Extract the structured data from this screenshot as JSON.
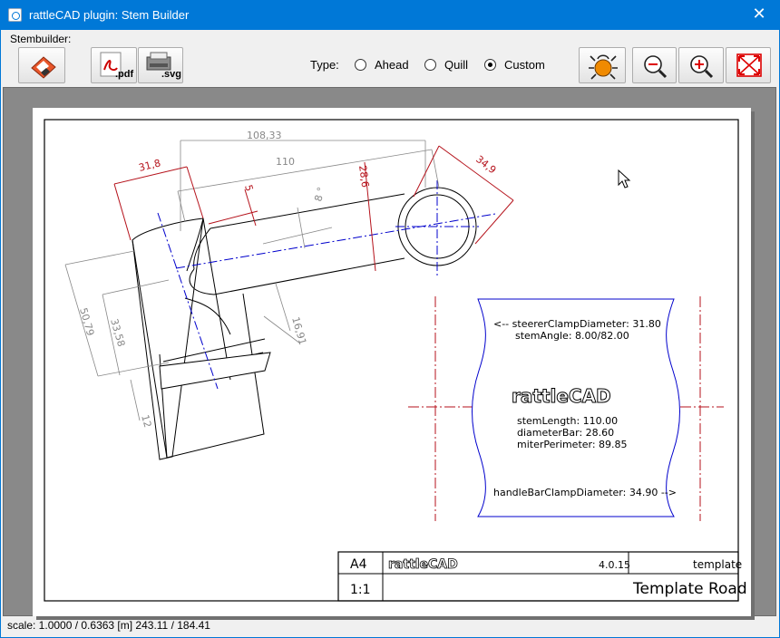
{
  "window": {
    "title": "rattleCAD plugin: Stem Builder",
    "close": "✕"
  },
  "toolbar": {
    "group_label": "Stembuilder:",
    "pdf_label": ".pdf",
    "svg_label": ".svg",
    "type_label": "Type:",
    "types": [
      {
        "label": "Ahead",
        "checked": false
      },
      {
        "label": "Quill",
        "checked": false
      },
      {
        "label": "Custom",
        "checked": true
      }
    ]
  },
  "drawing": {
    "dims": {
      "d108": "108,33",
      "d110": "110",
      "d318": "31,8",
      "d5": "5",
      "d8deg": "8 °",
      "d286": "28,6",
      "d349": "34,9",
      "d5079": "50,79",
      "d3358": "33,58",
      "d1691": "16,91",
      "d12": "12"
    },
    "info": {
      "steerer": "<-- steererClampDiameter:  31.80",
      "stemAngle": "stemAngle:  8.00/82.00",
      "logo": "rattleCAD",
      "stemLength": "stemLength:  110.00",
      "diameterBar": "diameterBar:  28.60",
      "miterPerimeter": "miterPerimeter:  89.85",
      "handlebar": "handleBarClampDiameter:  34.90  -->"
    },
    "titleblock": {
      "format": "A4",
      "logo": "rattleCAD",
      "version": "4.0.15",
      "template": "template",
      "scale": "1:1",
      "name": "Template Road"
    }
  },
  "status": {
    "text": "scale: 1.0000 / 0.6363  [m]  243.11 / 184.41"
  },
  "colors": {
    "dimension_red": "#b5121b",
    "axis_blue": "#0000cc",
    "titlebar": "#0078d7"
  }
}
